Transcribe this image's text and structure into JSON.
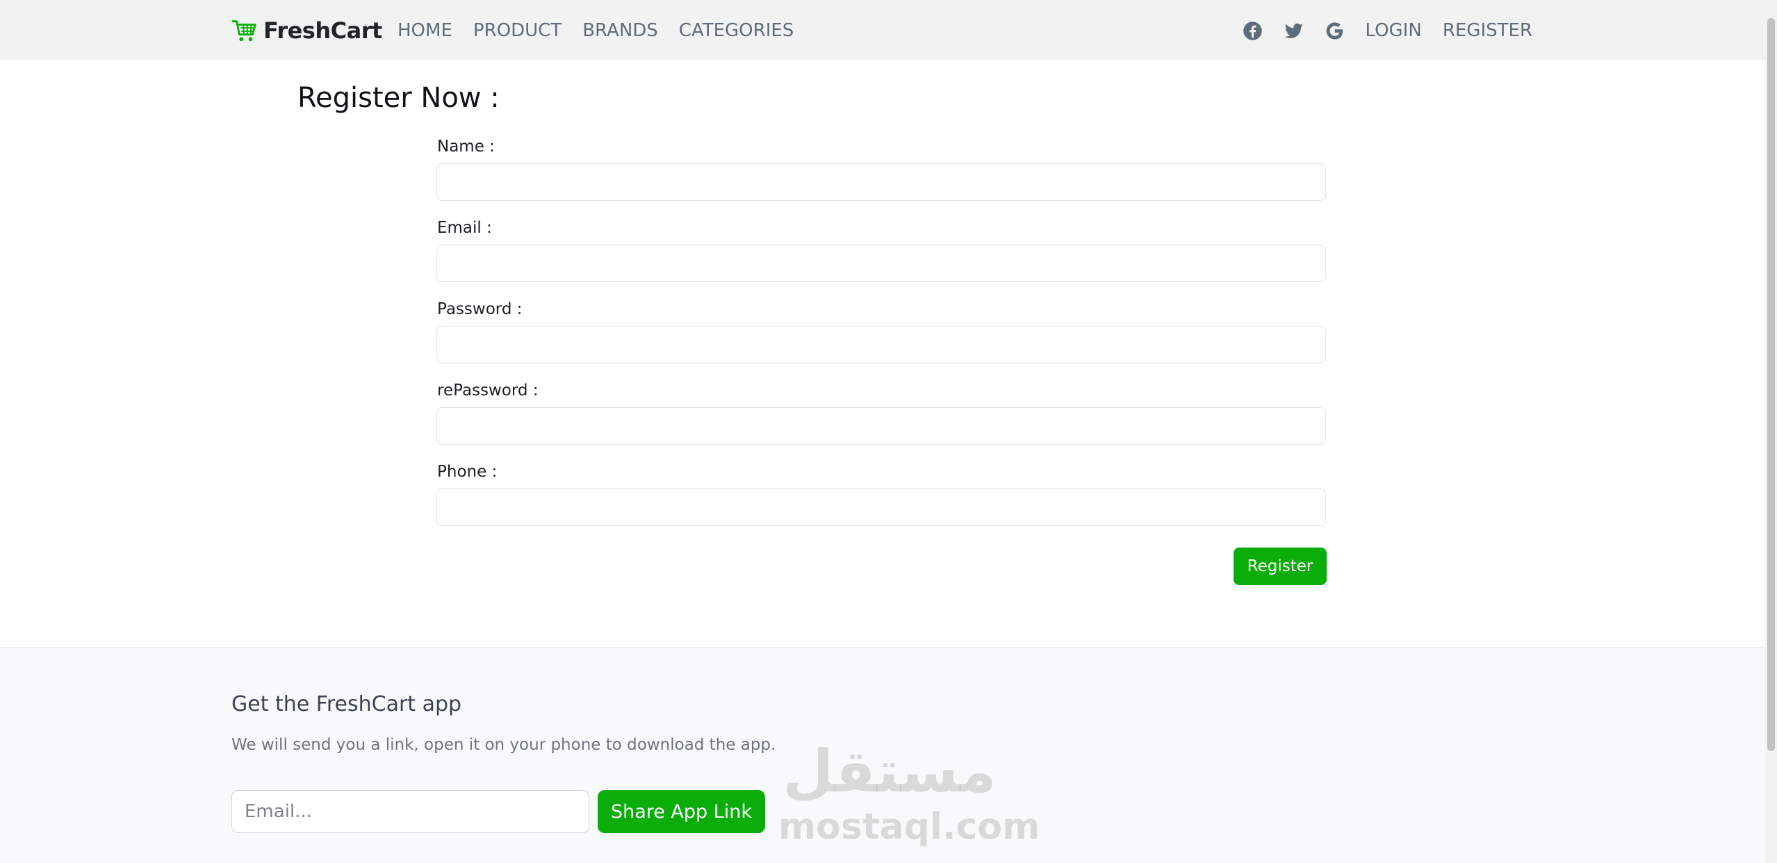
{
  "navbar": {
    "brand": "FreshCart",
    "links": [
      "HOME",
      "PRODUCT",
      "BRANDS",
      "CATEGORIES"
    ],
    "social_icons": [
      "facebook-icon",
      "twitter-icon",
      "google-icon"
    ],
    "login": "LOGIN",
    "register": "REGISTER"
  },
  "form": {
    "title": "Register Now :",
    "fields": [
      {
        "label": "Name :",
        "value": ""
      },
      {
        "label": "Email :",
        "value": ""
      },
      {
        "label": "Password :",
        "value": ""
      },
      {
        "label": "rePassword :",
        "value": ""
      },
      {
        "label": "Phone :",
        "value": ""
      }
    ],
    "submit_label": "Register"
  },
  "footer": {
    "title": "Get the FreshCart app",
    "text": "We will send you a link, open it on your phone to download the app.",
    "email_placeholder": "Email...",
    "share_label": "Share App Link"
  },
  "watermark": {
    "arabic": "مستقل",
    "latin": "mostaql.com"
  },
  "colors": {
    "accent": "#0aad0a",
    "navbar_bg": "#f0f3f2",
    "footer_bg": "#f8f9fa",
    "nav_text": "#5f6c7a"
  }
}
